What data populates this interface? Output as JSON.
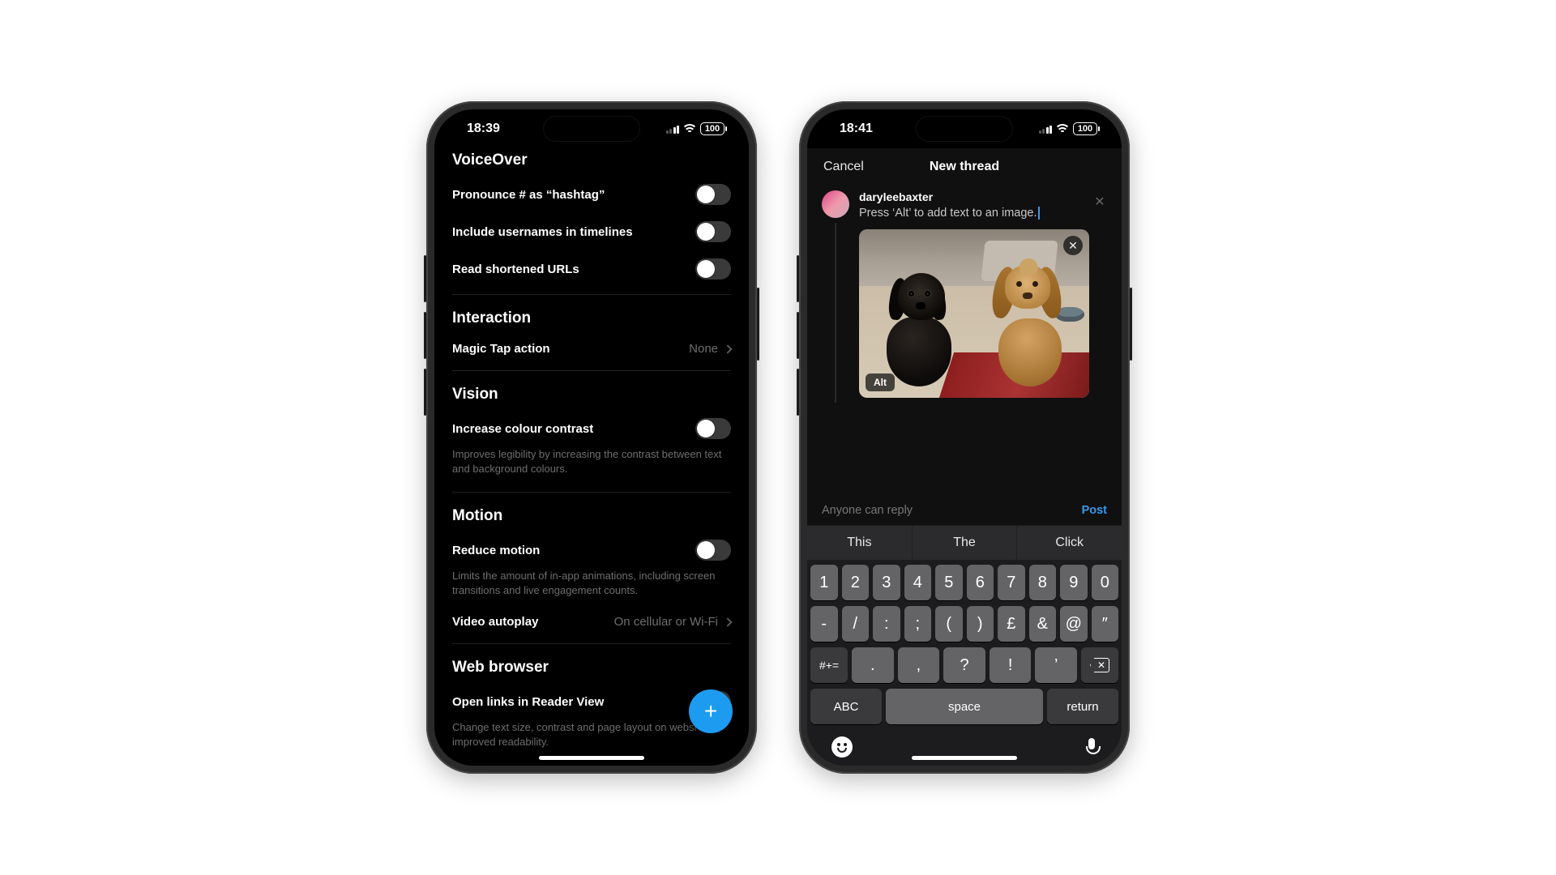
{
  "left": {
    "status": {
      "time": "18:39",
      "battery": "100"
    },
    "sections": {
      "voiceover": {
        "title": "VoiceOver",
        "items": [
          {
            "label": "Pronounce # as “hashtag”",
            "on": false
          },
          {
            "label": "Include usernames in timelines",
            "on": false
          },
          {
            "label": "Read shortened URLs",
            "on": false
          }
        ]
      },
      "interaction": {
        "title": "Interaction",
        "magic_tap": {
          "label": "Magic Tap action",
          "value": "None"
        }
      },
      "vision": {
        "title": "Vision",
        "contrast": {
          "label": "Increase colour contrast",
          "desc": "Improves legibility by increasing the contrast between text and background colours."
        }
      },
      "motion": {
        "title": "Motion",
        "reduce": {
          "label": "Reduce motion",
          "desc": "Limits the amount of in-app animations, including screen transitions and live engagement counts."
        },
        "autoplay": {
          "label": "Video autoplay",
          "value": "On cellular or Wi-Fi"
        }
      },
      "web": {
        "title": "Web browser",
        "reader": {
          "label": "Open links in Reader View",
          "desc": "Change text size, contrast and page layout on websi\nimproved readability."
        }
      }
    },
    "fab": "+"
  },
  "right": {
    "status": {
      "time": "18:41",
      "battery": "100"
    },
    "header": {
      "cancel": "Cancel",
      "title": "New thread"
    },
    "compose": {
      "username": "daryleebaxter",
      "text": "Press ‘Alt’ to add text to an image.",
      "alt_badge": "Alt"
    },
    "reply_bar": {
      "who": "Anyone can reply",
      "post": "Post"
    },
    "suggestions": [
      "This",
      "The",
      "Click"
    ],
    "keyboard": {
      "row1": [
        "1",
        "2",
        "3",
        "4",
        "5",
        "6",
        "7",
        "8",
        "9",
        "0"
      ],
      "row2": [
        "-",
        "/",
        ":",
        ";",
        "(",
        ")",
        "£",
        "&",
        "@",
        "″"
      ],
      "shift": "#+=",
      "row3": [
        ".",
        ",",
        "?",
        "!",
        "’"
      ],
      "abc": "ABC",
      "space": "space",
      "ret": "return"
    }
  }
}
